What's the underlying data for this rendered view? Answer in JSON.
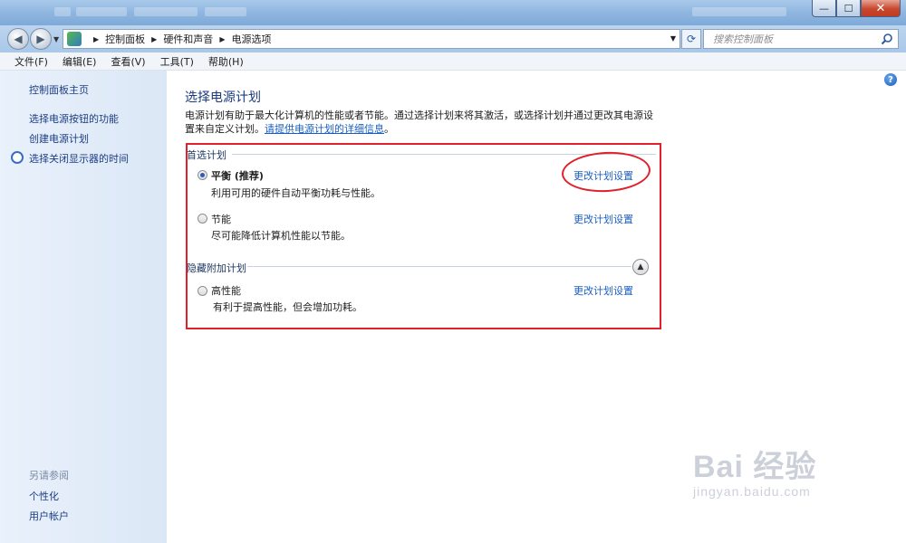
{
  "window": {
    "minimize": "—",
    "maximize": "☐",
    "close": "✕"
  },
  "navbar": {
    "back": "◀",
    "forward": "▶",
    "breadcrumb": [
      "控制面板",
      "硬件和声音",
      "电源选项"
    ],
    "search_placeholder": "搜索控制面板"
  },
  "menubar": {
    "items": [
      "文件(F)",
      "编辑(E)",
      "查看(V)",
      "工具(T)",
      "帮助(H)"
    ]
  },
  "sidebar": {
    "home": "控制面板主页",
    "links": [
      "选择电源按钮的功能",
      "创建电源计划",
      "选择关闭显示器的时间"
    ],
    "see_also_title": "另请参阅",
    "see_also": [
      "个性化",
      "用户帐户"
    ]
  },
  "main": {
    "title": "选择电源计划",
    "description": "电源计划有助于最大化计算机的性能或者节能。通过选择计划来将其激活，或选择计划并通过更改其电源设置来自定义计划。",
    "description_link": "请提供电源计划的详细信息",
    "preferred_title": "首选计划",
    "hidden_title": "隐藏附加计划",
    "plans": [
      {
        "name": "平衡 (推荐)",
        "description": "利用可用的硬件自动平衡功耗与性能。",
        "link": "更改计划设置",
        "selected": true
      },
      {
        "name": "节能",
        "description": "尽可能降低计算机性能以节能。",
        "link": "更改计划设置",
        "selected": false
      },
      {
        "name": "高性能",
        "description": "有利于提高性能，但会增加功耗。",
        "link": "更改计划设置",
        "selected": false
      }
    ]
  },
  "watermark": {
    "brand": "Bai 经验",
    "url": "jingyan.baidu.com"
  },
  "colors": {
    "link": "#1a5fc1",
    "highlight": "#e0202a",
    "title": "#1a3b7d"
  }
}
